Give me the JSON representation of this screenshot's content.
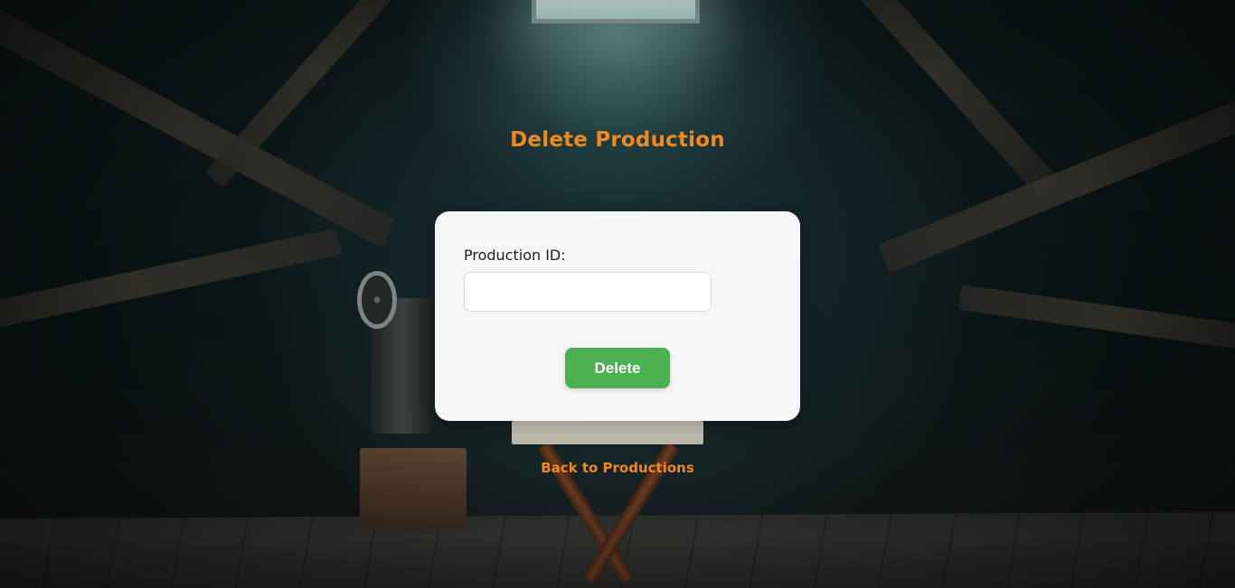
{
  "page": {
    "title": "Delete Production"
  },
  "form": {
    "production_id_label": "Production ID:",
    "production_id_value": "",
    "production_id_placeholder": "",
    "delete_label": "Delete"
  },
  "links": {
    "back_label": "Back to Productions"
  },
  "colors": {
    "accent": "#f0891f",
    "button": "#4caf50",
    "card": "#f6f7f9"
  }
}
